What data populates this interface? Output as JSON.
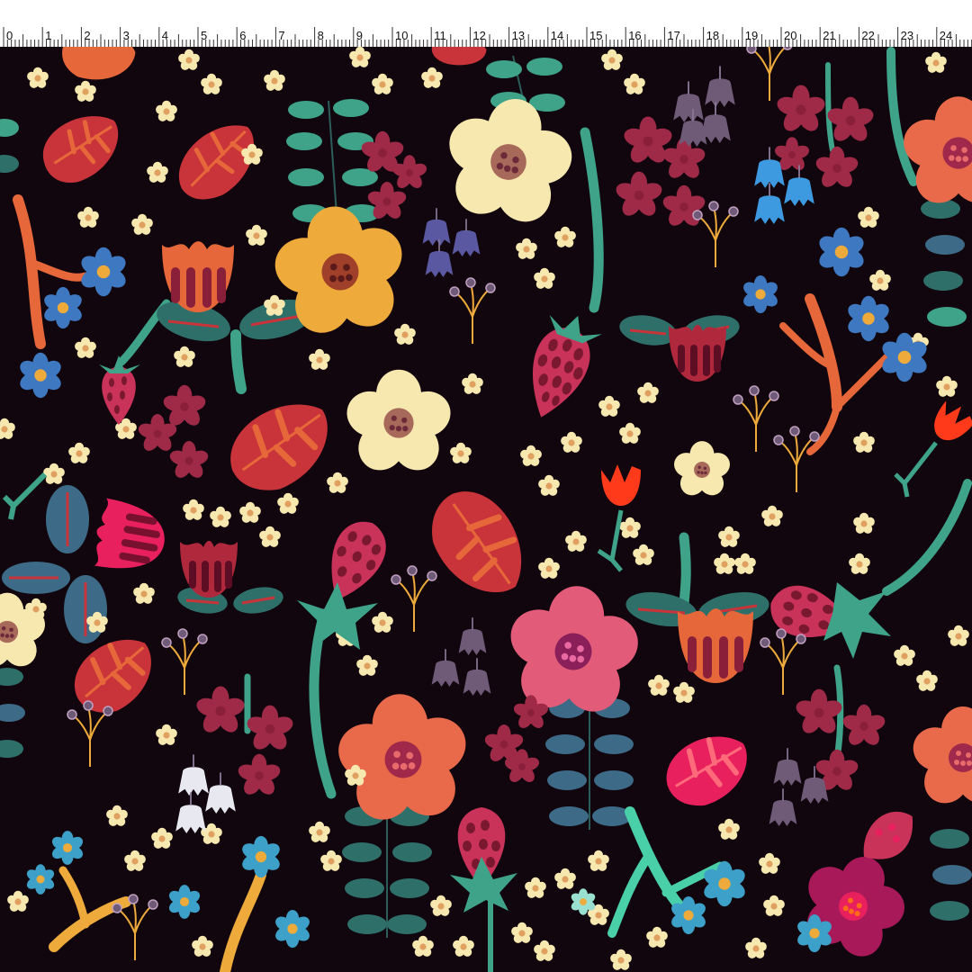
{
  "ruler": {
    "labels": [
      "0",
      "1",
      "2",
      "3",
      "4",
      "5",
      "6",
      "7",
      "8",
      "9",
      "10",
      "11",
      "12",
      "13",
      "14",
      "15",
      "16",
      "17",
      "18",
      "19",
      "20",
      "21",
      "22",
      "23",
      "24",
      "2"
    ]
  },
  "palette": {
    "background": "#12060e",
    "cream": "#f7e8b0",
    "yellow": "#eeaa3a",
    "coral": "#e86a4a",
    "pink": "#e25c7a",
    "magenta": "#e8205e",
    "red_leaf": "#c9333a",
    "orange_leaf": "#e6683a",
    "teal": "#3fa38a",
    "blue_leaf": "#3d6a86",
    "blue_flower": "#3d78c0",
    "mauve": "#6f5a78",
    "berry": "#9e2a48",
    "wine": "#8a1f3a"
  },
  "motifs": [
    "daisy-flower-icon",
    "leaf-icon",
    "strawberry-icon",
    "bellflower-icon",
    "star-flower-icon",
    "tulip-icon",
    "fern-sprig-icon",
    "berry-sprig-icon"
  ]
}
